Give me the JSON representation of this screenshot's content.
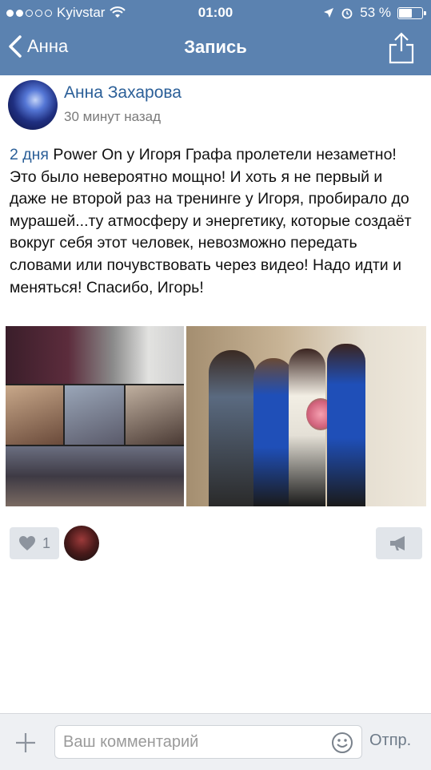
{
  "status_bar": {
    "carrier": "Kyivstar",
    "time": "01:00",
    "battery": "53 %",
    "battery_level": 0.53
  },
  "nav": {
    "back_label": "Анна",
    "title": "Запись"
  },
  "post": {
    "author": "Анна Захарова",
    "time_ago": "30 минут назад",
    "link_text": "2 дня",
    "body": " Power On у Игоря Графа пролетели незаметно! Это было невероятно мощно! И хоть я не первый и даже не второй раз на тренинге у Игоря, пробирало до мурашей...ту атмосферу и энергетику, которые создаёт вокруг себя этот человек, невозможно передать словами или почувствовать через видео! Надо идти и меняться! Спасибо, Игорь!",
    "likes": "1"
  },
  "comment": {
    "placeholder": "Ваш комментарий",
    "send_label": "Отпр."
  },
  "icons": {
    "back": "chevron-left-icon",
    "share": "share-icon",
    "like": "heart-icon",
    "repost": "megaphone-icon",
    "attach": "plus-icon",
    "emoji": "smiley-icon"
  },
  "colors": {
    "header": "#5b82b0",
    "link": "#2b5f98",
    "button_bg": "#e1e5ea"
  }
}
